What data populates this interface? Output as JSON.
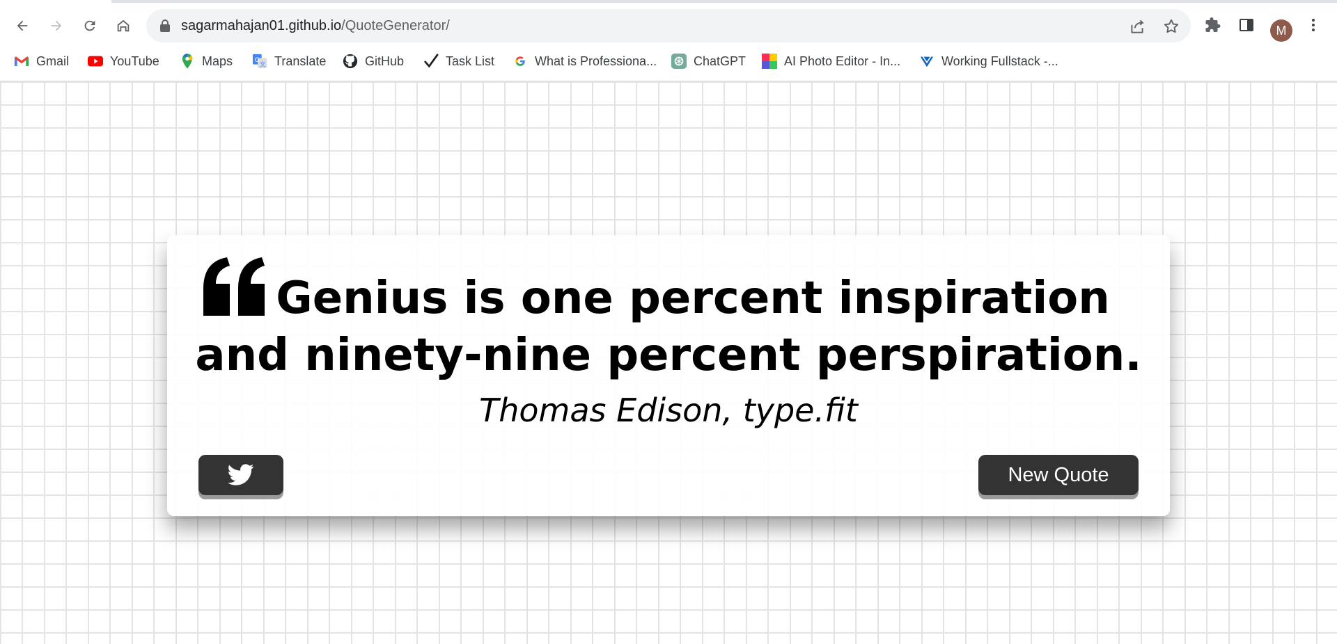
{
  "browser": {
    "url_host": "sagarmahajan01.github.io",
    "url_path": "/QuoteGenerator/",
    "profile_initial": "M",
    "bookmarks": [
      {
        "label": "Gmail",
        "icon": "gmail-icon"
      },
      {
        "label": "YouTube",
        "icon": "youtube-icon"
      },
      {
        "label": "Maps",
        "icon": "maps-icon"
      },
      {
        "label": "Translate",
        "icon": "translate-icon"
      },
      {
        "label": "GitHub",
        "icon": "github-icon"
      },
      {
        "label": "Task List",
        "icon": "checkmark-icon"
      },
      {
        "label": "What is Professiona...",
        "icon": "google-icon"
      },
      {
        "label": "ChatGPT",
        "icon": "chatgpt-icon"
      },
      {
        "label": "AI Photo Editor - In...",
        "icon": "photo-editor-icon"
      },
      {
        "label": "Working Fullstack -...",
        "icon": "fullstack-icon"
      }
    ]
  },
  "quote": {
    "text": "Genius is one percent inspiration and ninety-nine percent perspiration.",
    "author": "Thomas Edison, type.fit",
    "new_quote_label": "New Quote",
    "twitter_icon": "twitter-icon"
  },
  "colors": {
    "button_bg": "#333333",
    "button_shadow": "#9a9a9a",
    "brick_line": "#e4e4e4"
  }
}
